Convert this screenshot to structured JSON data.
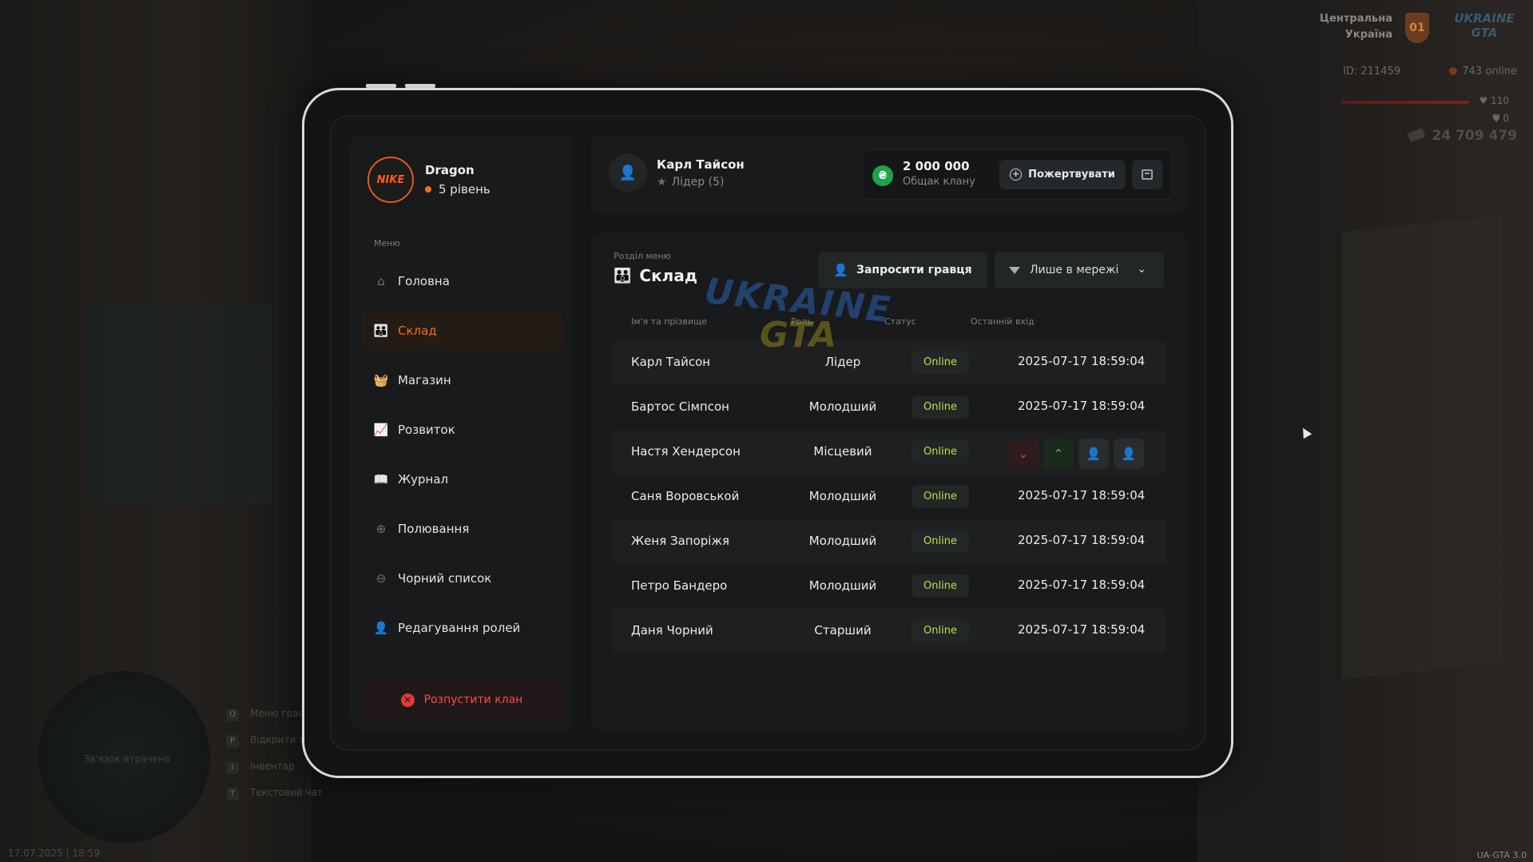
{
  "hud": {
    "location_line1": "Центральна",
    "location_line2": "Україна",
    "region_badge": "01",
    "logo_line1": "UKRAINE",
    "logo_line2": "GTA",
    "player_id": "ID: 211459",
    "online": "743 online",
    "health": "110",
    "armor": "0",
    "money": "24 709 479",
    "minimap_status": "Зв'язок втрачено",
    "hints": [
      {
        "key": "O",
        "label": "Меню гравця"
      },
      {
        "key": "P",
        "label": "Відкрити телефон"
      },
      {
        "key": "I",
        "label": "Інвентар"
      },
      {
        "key": "T",
        "label": "Текстовий чат"
      }
    ],
    "datetime": "17.07.2025 | 18:59",
    "version": "UA-GTA 3.0"
  },
  "clan": {
    "logo_text": "NIKE",
    "name": "Dragon",
    "level": "5 рівень"
  },
  "sidebar": {
    "menu_caption": "Меню",
    "items": [
      {
        "label": "Головна",
        "icon": "home-icon",
        "glyph": "⌂",
        "active": false
      },
      {
        "label": "Склад",
        "icon": "members-icon",
        "glyph": "👪",
        "active": true
      },
      {
        "label": "Магазин",
        "icon": "shop-basket-icon",
        "glyph": "🧺",
        "active": false
      },
      {
        "label": "Розвиток",
        "icon": "chart-line-icon",
        "glyph": "📈",
        "active": false
      },
      {
        "label": "Журнал",
        "icon": "book-icon",
        "glyph": "📖",
        "active": false
      },
      {
        "label": "Полювання",
        "icon": "crosshair-icon",
        "glyph": "⊕",
        "active": false
      },
      {
        "label": "Чорний список",
        "icon": "minus-circle-icon",
        "glyph": "⊖",
        "active": false
      },
      {
        "label": "Редагування ролей",
        "icon": "user-edit-icon",
        "glyph": "👤",
        "active": false
      }
    ],
    "disband_label": "Розпустити клан"
  },
  "header": {
    "user_name": "Карл Тайсон",
    "user_role": "Лідер (5)",
    "fund_amount": "2 000 000",
    "fund_label": "Общак клану",
    "currency_symbol": "₴",
    "donate_label": "Пожертвувати"
  },
  "section": {
    "caption": "Розділ меню",
    "title": "Склад",
    "invite_label": "Запросити гравця",
    "filter_value": "Лише в мережі"
  },
  "table": {
    "columns": [
      "Ім'я та прізвище",
      "Роль",
      "Статус",
      "Останній вхід"
    ],
    "rows": [
      {
        "name": "Карл Тайсон",
        "role": "Лідер",
        "status": "Online",
        "last_login": "2025-07-17 18:59:04"
      },
      {
        "name": "Бартос Сімпсон",
        "role": "Молодший",
        "status": "Online",
        "last_login": "2025-07-17 18:59:04"
      },
      {
        "name": "Настя Хендерсон",
        "role": "Місцевий",
        "status": "Online",
        "last_login": ""
      },
      {
        "name": "Саня Воровськой",
        "role": "Молодший",
        "status": "Online",
        "last_login": "2025-07-17 18:59:04"
      },
      {
        "name": "Женя Запоріжя",
        "role": "Молодший",
        "status": "Online",
        "last_login": "2025-07-17 18:59:04"
      },
      {
        "name": "Петро Бандеро",
        "role": "Молодший",
        "status": "Online",
        "last_login": "2025-07-17 18:59:04"
      },
      {
        "name": "Даня Чорний",
        "role": "Старший",
        "status": "Online",
        "last_login": "2025-07-17 18:59:04"
      }
    ]
  },
  "watermark": {
    "line1": "UKRAINE",
    "line2": "GTA"
  },
  "colors": {
    "accent": "#ff6a14",
    "status_online": "#b8e04a",
    "danger": "#e23838",
    "fund_green": "#1fa34a"
  }
}
